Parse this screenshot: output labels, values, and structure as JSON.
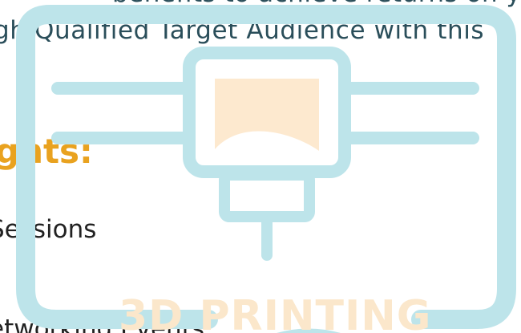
{
  "content": {
    "top_line": "benefits to achieve returns on your i",
    "sub_line": "gh Qualified Target Audience with this",
    "heading": "ghts:",
    "items": [
      {
        "label": "Sessions"
      },
      {
        "label": "etworking Events"
      }
    ]
  },
  "watermark": {
    "label": "3D PRINTING",
    "icon": "3d-printer-icon",
    "colors": {
      "outline": "#bde4ea",
      "fill": "#fde9cf",
      "label": "#fbe7cb"
    }
  },
  "colors": {
    "heading": "#e9a21f",
    "body_text": "#2a4e5a",
    "list_text": "#222222"
  }
}
